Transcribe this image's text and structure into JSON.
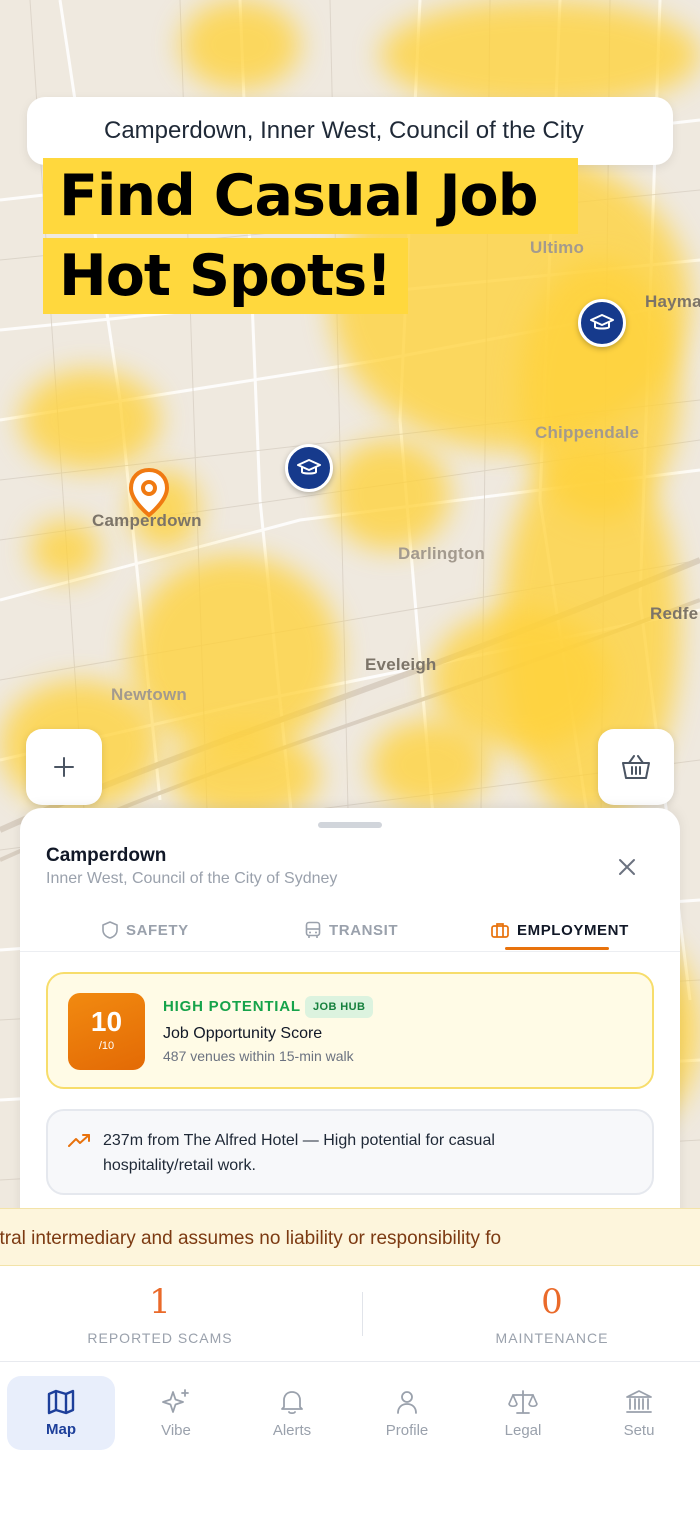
{
  "search": {
    "location_text": "Camperdown, Inner West, Council of the City"
  },
  "headline": {
    "line1": "Find Casual Job",
    "line2": "Hot Spots!"
  },
  "map_labels": {
    "ultimo": "Ultimo",
    "haymarket": "Hayma",
    "chippendale": "Chippendale",
    "camperdown": "Camperdown",
    "darlington": "Darlington",
    "redfern": "Redfe",
    "eveleigh": "Eveleigh",
    "newtown": "Newtown"
  },
  "sheet": {
    "title": "Camperdown",
    "subtitle": "Inner West, Council of the City of Sydney",
    "tabs": [
      {
        "label": "SAFETY",
        "icon": "shield-icon"
      },
      {
        "label": "TRANSIT",
        "icon": "bus-icon"
      },
      {
        "label": "EMPLOYMENT",
        "icon": "briefcase-icon",
        "active": true
      }
    ],
    "score": {
      "value": "10",
      "out_of": "/10",
      "potential": "HIGH POTENTIAL",
      "badge": "JOB HUB",
      "label": "Job Opportunity Score",
      "detail": "487 venues within 15-min walk"
    },
    "insight": "237m from The Alfred Hotel — High potential for casual hospitality/retail work."
  },
  "ticker": {
    "text": "y Ltd acts as a neutral intermediary and assumes no liability or responsibility fo"
  },
  "stats": {
    "reported_scams": {
      "value": "1",
      "label": "REPORTED SCAMS"
    },
    "maintenance": {
      "value": "0",
      "label": "MAINTENANCE"
    }
  },
  "nav": [
    {
      "label": "Map",
      "icon": "map-icon",
      "active": true
    },
    {
      "label": "Vibe",
      "icon": "sparkles-icon"
    },
    {
      "label": "Alerts",
      "icon": "bell-icon"
    },
    {
      "label": "Profile",
      "icon": "user-icon"
    },
    {
      "label": "Legal",
      "icon": "scales-icon"
    },
    {
      "label": "Setu",
      "icon": "bank-icon"
    }
  ],
  "colors": {
    "accent": "#e8720c",
    "heat": "#ffd23a",
    "brand_blue": "#163a8c",
    "success": "#16a34a"
  }
}
